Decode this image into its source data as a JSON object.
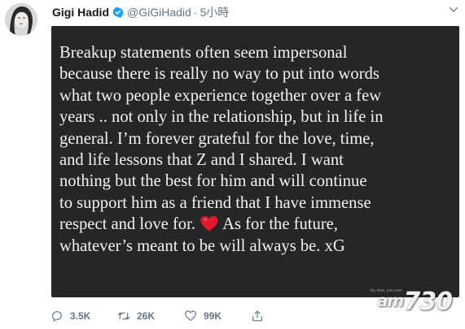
{
  "tweet": {
    "author_name": "Gigi Hadid",
    "author_handle": "@GiGiHadid",
    "separator": "·",
    "time_ago": "5小時",
    "statement_part1": "Breakup statements often seem impersonal\nbecause there is really no way to put into words\nwhat two people experience together over a few\nyears .. not only in the relationship, but in life in\ngeneral. I’m forever grateful for the love, time,\nand life lessons that Z and I shared. I want\nnothing but the best for him and will continue\nto support him as a friend that I have immense\nrespect and love for. ",
    "statement_part2": " As for the future,\nwhatever’s meant to be will always be. xG",
    "card_credit": "my dear, you ever",
    "reply_count": "3.5K",
    "retweet_count": "26K",
    "like_count": "99K"
  },
  "icons": {
    "verified": "verified-badge-icon",
    "caret": "chevron-down-icon",
    "heart": "red-heart-emoji",
    "reply": "reply-icon",
    "retweet": "retweet-icon",
    "like": "like-heart-icon",
    "share": "share-icon"
  },
  "watermark": {
    "prefix": "am",
    "number": "730"
  },
  "colors": {
    "card_bg": "#262628",
    "card_text": "#f2f2f2",
    "verified_blue": "#1da1f2",
    "meta_gray": "#657786",
    "heart_red": "#e0192b"
  }
}
